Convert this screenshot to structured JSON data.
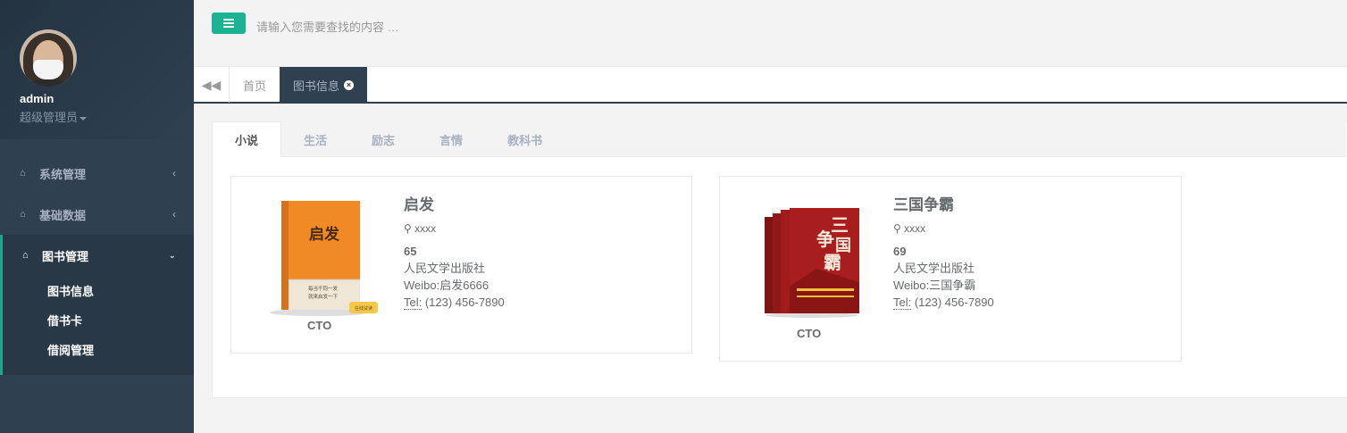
{
  "user": {
    "name": "admin",
    "role": "超级管理员"
  },
  "sidebar": {
    "items": [
      {
        "label": "系统管理",
        "icon": "home-icon"
      },
      {
        "label": "基础数据",
        "icon": "home-icon"
      }
    ],
    "active_group": {
      "label": "图书管理",
      "icon": "home-icon",
      "subs": [
        {
          "label": "图书信息"
        },
        {
          "label": "借书卡"
        },
        {
          "label": "借阅管理"
        }
      ]
    }
  },
  "search": {
    "placeholder": "请输入您需要查找的内容 …"
  },
  "page_tabs": [
    {
      "label": "首页"
    },
    {
      "label": "图书信息",
      "active": true
    }
  ],
  "categories": [
    "小说",
    "生活",
    "励志",
    "言情",
    "教科书"
  ],
  "books": [
    {
      "title": "启发",
      "location": "xxxx",
      "number": "65",
      "publisher": "人民文学出版社",
      "weibo": "Weibo:启发6666",
      "tel_label": "Tel:",
      "tel": " (123) 456-7890",
      "role": "CTO",
      "cover_title": "启发",
      "cover_sub": "每当千钧一发 就来启发一下",
      "cover_badge": "在线试读"
    },
    {
      "title": "三国争霸",
      "location": "xxxx",
      "number": "69",
      "publisher": "人民文学出版社",
      "weibo": "Weibo:三国争霸",
      "tel_label": "Tel:",
      "tel": " (123) 456-7890",
      "role": "CTO",
      "cover_title": "三国争霸"
    }
  ],
  "colors": {
    "sidebar": "#2f4050",
    "accent": "#1ab394",
    "page": "#f3f3f4"
  }
}
